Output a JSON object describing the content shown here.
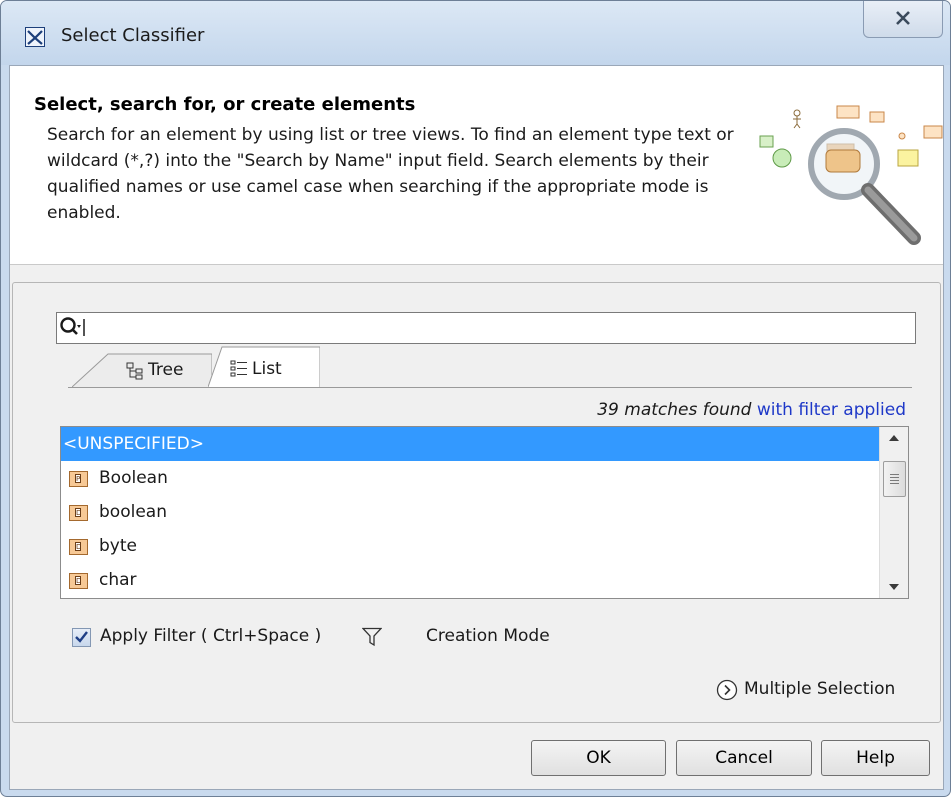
{
  "window": {
    "title": "Select Classifier",
    "app_icon": "magicdraw-app-icon",
    "close_icon": "close-icon"
  },
  "header": {
    "title": "Select, search for, or create elements",
    "description": "Search for an element by using list or tree views. To find an element type text or wildcard (*,?) into the \"Search by Name\" input field. Search elements by their qualified names or use camel case when searching if the appropriate mode is enabled.",
    "illustration": "magnifier-search-illustration"
  },
  "search": {
    "value": "",
    "icon": "search-options-icon"
  },
  "tabs": [
    {
      "label": "Tree",
      "icon": "tree-view-icon",
      "active": false
    },
    {
      "label": "List",
      "icon": "list-view-icon",
      "active": true
    }
  ],
  "results": {
    "count_text": "39 matches found",
    "filter_text": "with filter applied"
  },
  "list_items": [
    {
      "label": "<UNSPECIFIED>",
      "icon": "",
      "selected": true
    },
    {
      "label": "Boolean",
      "icon": "P",
      "selected": false
    },
    {
      "label": "boolean",
      "icon": "D",
      "selected": false
    },
    {
      "label": "byte",
      "icon": "D",
      "selected": false
    },
    {
      "label": "char",
      "icon": "D",
      "selected": false
    }
  ],
  "scroll": {
    "position_fraction": 0.15
  },
  "options": {
    "apply_filter_label": "Apply Filter ( Ctrl+Space )",
    "apply_filter_checked": true,
    "filter_icon": "funnel-icon",
    "creation_mode_label": "Creation Mode",
    "multiple_selection_label": "Multiple Selection",
    "multiple_selection_icon": "expand-circle-icon"
  },
  "buttons": {
    "ok": "OK",
    "cancel": "Cancel",
    "help": "Help"
  },
  "colors": {
    "selection": "#3399ff",
    "link": "#1e38c8",
    "item_icon_fill": "#f7c996",
    "title_bar": "#c9daee"
  }
}
